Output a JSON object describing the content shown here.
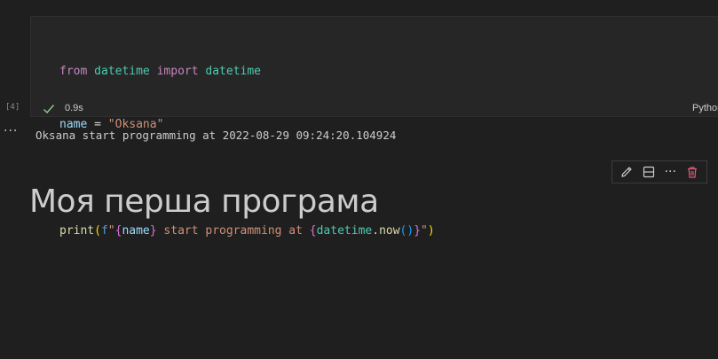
{
  "code_cell": {
    "execution_count": "[4]",
    "duration": "0.9s",
    "language": "Python",
    "lines": [
      [
        "from",
        " ",
        "datetime",
        " ",
        "import",
        " ",
        "datetime"
      ],
      [
        "name",
        " = ",
        "\"Oksana\""
      ],
      [
        ""
      ],
      [
        "print",
        "(",
        "f",
        "\"",
        "{",
        "name",
        "}",
        " start programming at ",
        "{",
        "datetime",
        ".",
        "now",
        "(",
        ")",
        "}",
        "\"",
        ")"
      ]
    ]
  },
  "output": {
    "more_label": "···",
    "text": "Oksana start programming at 2022-08-29 09:24:20.104924"
  },
  "cell_toolbar": {
    "icons": [
      "pencil-icon",
      "split-cell-icon",
      "more-actions-icon",
      "trash-icon"
    ],
    "more_label": "···"
  },
  "markdown_cell": {
    "heading": "Моя перша програма"
  },
  "colors": {
    "background": "#1f1f1f",
    "code_background": "#262626",
    "success_check": "#89d185",
    "delete_icon": "#e05a7a"
  }
}
